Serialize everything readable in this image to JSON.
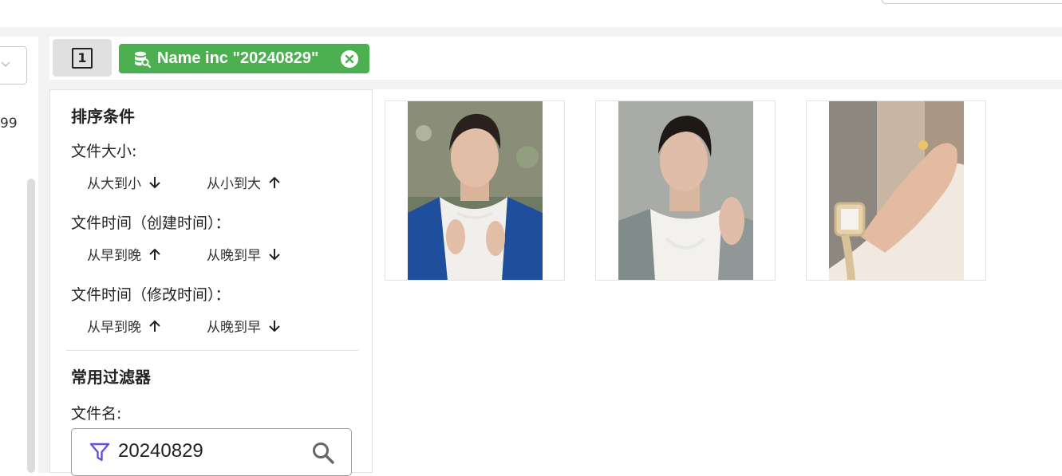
{
  "left_panel": {
    "partial_number": "99"
  },
  "filterbar": {
    "page_number": "1",
    "chip": {
      "label": "Name inc \"20240829\"",
      "color": "#4caf50",
      "icon": "database-search-icon",
      "close_icon": "close-circle-icon"
    }
  },
  "sort": {
    "title": "排序条件",
    "groups": [
      {
        "label": "文件大小:",
        "options": [
          {
            "label": "从大到小",
            "arrow": "arrow-down-icon"
          },
          {
            "label": "从小到大",
            "arrow": "arrow-up-icon"
          }
        ]
      },
      {
        "label": "文件时间（创建时间）：",
        "options": [
          {
            "label": "从早到晚",
            "arrow": "arrow-up-icon"
          },
          {
            "label": "从晚到早",
            "arrow": "arrow-down-icon"
          }
        ]
      },
      {
        "label": "文件时间（修改时间）：",
        "options": [
          {
            "label": "从早到晚",
            "arrow": "arrow-up-icon"
          },
          {
            "label": "从晚到早",
            "arrow": "arrow-down-icon"
          }
        ]
      }
    ]
  },
  "filters": {
    "title": "常用过滤器",
    "filename_label": "文件名:",
    "filename_value": "20240829",
    "funnel_color": "#6a4fd8"
  },
  "thumbnails": [
    {
      "alt": "photo-1"
    },
    {
      "alt": "photo-2"
    },
    {
      "alt": "photo-3"
    }
  ]
}
